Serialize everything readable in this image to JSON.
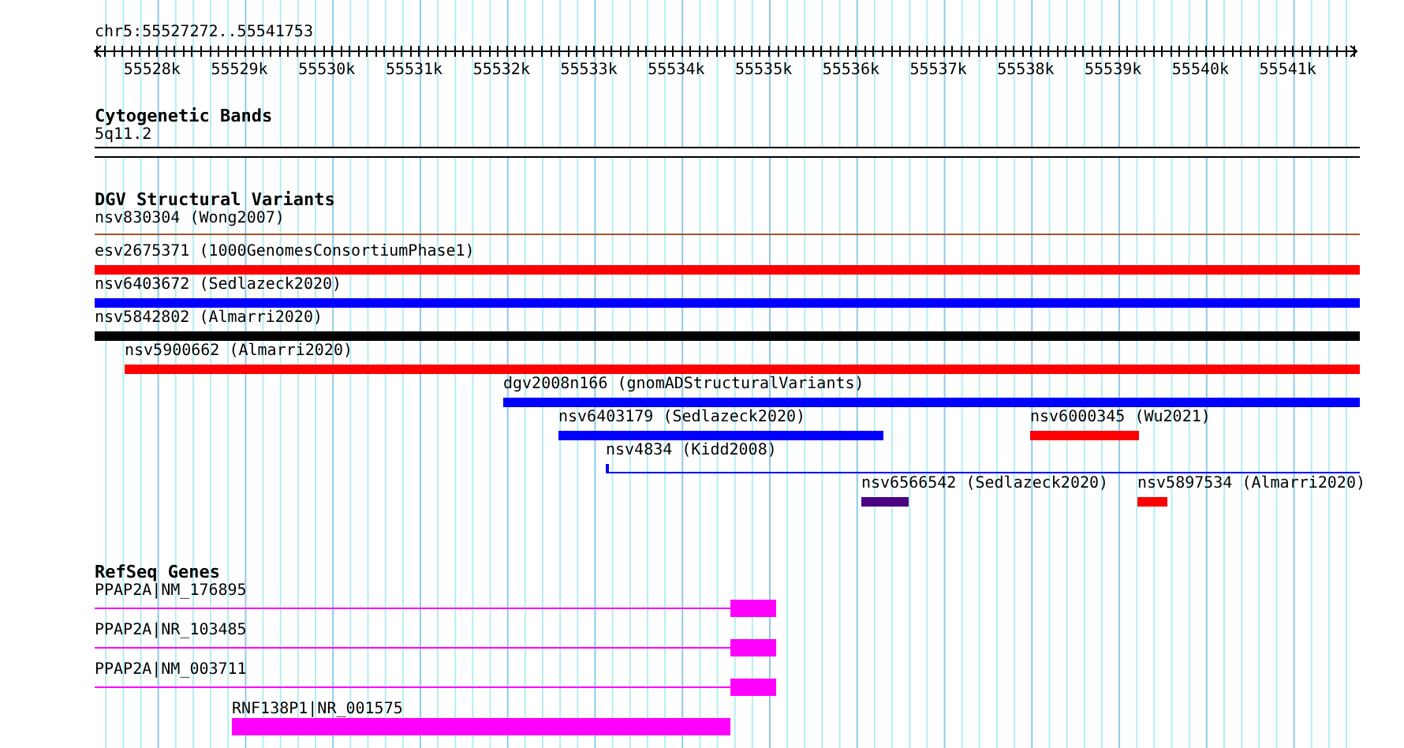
{
  "location": "chr5:55527272..55541753",
  "ruler_ticks": [
    "55528k",
    "55529k",
    "55530k",
    "55531k",
    "55532k",
    "55533k",
    "55534k",
    "55535k",
    "55536k",
    "55537k",
    "55538k",
    "55539k",
    "55540k",
    "55541k"
  ],
  "cytogenetic_bands": {
    "title": "Cytogenetic Bands",
    "band": "5q11.2"
  },
  "structural_variants": {
    "title": "DGV Structural Variants",
    "rows": [
      [
        {
          "label": "nsv830304 (Wong2007)",
          "kind": "line",
          "color": "#a0522d"
        }
      ],
      [
        {
          "label": "esv2675371 (1000GenomesConsortiumPhase1)",
          "kind": "bar",
          "color": "#ff0000"
        }
      ],
      [
        {
          "label": "nsv6403672 (Sedlazeck2020)",
          "kind": "bar",
          "color": "#0000ff"
        }
      ],
      [
        {
          "label": "nsv5842802 (Almarri2020)",
          "kind": "bar",
          "color": "#000000"
        }
      ],
      [
        {
          "label": "nsv5900662 (Almarri2020)",
          "kind": "bar",
          "color": "#ff0000"
        }
      ],
      [
        {
          "label": "dgv2008n166 (gnomADStructuralVariants)",
          "kind": "bar",
          "color": "#0000ff"
        }
      ],
      [
        {
          "label": "nsv6403179 (Sedlazeck2020)",
          "kind": "bar",
          "color": "#0000ff"
        },
        {
          "label": "nsv6000345 (Wu2021)",
          "kind": "bar",
          "color": "#ff0000"
        }
      ],
      [
        {
          "label": "nsv4834 (Kidd2008)",
          "kind": "capped_line",
          "color": "#0000ff"
        }
      ],
      [
        {
          "label": "nsv6566542 (Sedlazeck2020)",
          "kind": "bar",
          "color": "#4b0082"
        },
        {
          "label": "nsv5897534 (Almarri2020)",
          "kind": "bar",
          "color": "#ff0000"
        }
      ]
    ]
  },
  "refseq_genes": {
    "title": "RefSeq Genes",
    "rows": [
      {
        "label": "PPAP2A|NM_176895",
        "kind": "transcript"
      },
      {
        "label": "PPAP2A|NR_103485",
        "kind": "transcript"
      },
      {
        "label": "PPAP2A|NM_003711",
        "kind": "transcript"
      },
      {
        "label": "RNF138P1|NR_001575",
        "kind": "block"
      }
    ]
  }
}
